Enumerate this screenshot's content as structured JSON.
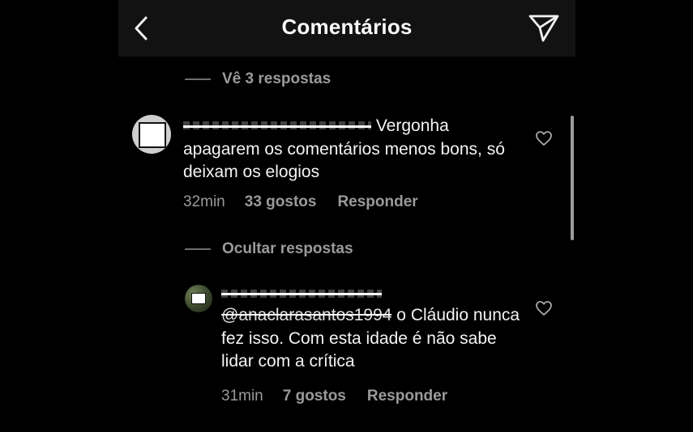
{
  "header": {
    "title": "Comentários",
    "back_icon": "chevron-left-icon",
    "send_icon": "paper-plane-icon"
  },
  "thread_top": {
    "label": "Vê 3 respostas"
  },
  "comment_main": {
    "username_redacted": true,
    "text": " Vergonha apagarem os comentários menos bons, só deixam os elogios",
    "time": "32min",
    "likes": "33 gostos",
    "reply_label": "Responder"
  },
  "thread_hide": {
    "label": "Ocultar respostas"
  },
  "comment_reply": {
    "username_redacted": true,
    "mention": "@anaclarasantos1994",
    "text": " o Cláudio nunca fez isso. Com esta idade é não sabe lidar com a crítica",
    "time": "31min",
    "likes": "7 gostos",
    "reply_label": "Responder"
  },
  "colors": {
    "background": "#000000",
    "header_bg": "#121212",
    "text_primary": "#f4f4f4",
    "text_secondary": "#9a9a9a"
  }
}
